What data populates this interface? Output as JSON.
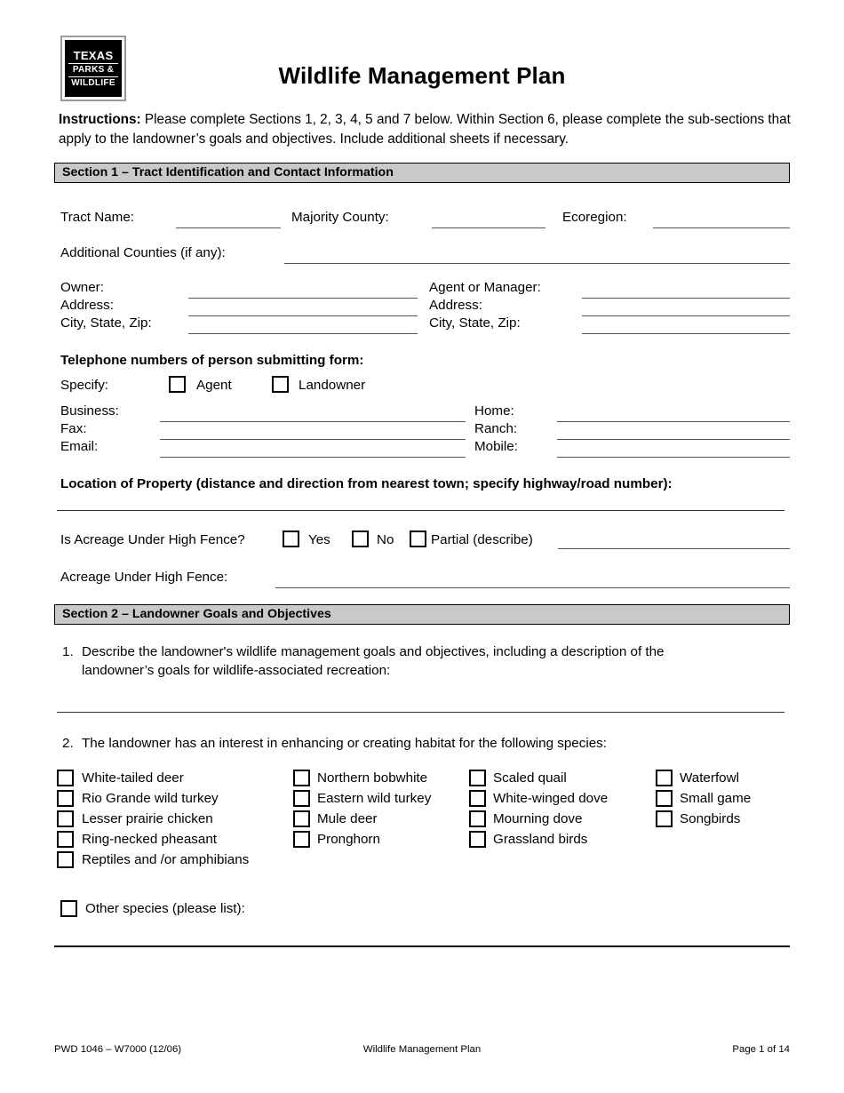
{
  "document": {
    "title": "Wildlife Management Plan",
    "logo": {
      "line1": "TEXAS",
      "line2": "PARKS &",
      "line3": "WILDLIFE"
    },
    "instructions": {
      "label": "Instructions:",
      "text": "Please complete Sections 1, 2, 3, 4, 5 and 7 below.  Within Section 6, please complete the sub-sections that apply to the landowner’s goals and objectives.  Include additional sheets if necessary."
    }
  },
  "section1": {
    "heading": "Section 1 – Tract Identification and Contact Information",
    "tract_name_label": "Tract Name:",
    "majority_county_label": "Majority County:",
    "ecoregion_label": "Ecoregion:",
    "additional_counties_label": "Additional Counties (if any):",
    "owner_label": "Owner:",
    "owner_address_label": "Address:",
    "owner_city_label": "City, State, Zip:",
    "agent_label": "Agent or Manager:",
    "agent_address_label": "Address:",
    "agent_city_label": "City, State, Zip:",
    "telephone_heading": "Telephone numbers of person submitting form:",
    "specify_label": "Specify:",
    "specify_options": [
      "Agent",
      "Landowner"
    ],
    "business_label": "Business:",
    "fax_label": "Fax:",
    "email_label": "Email:",
    "home_label": "Home:",
    "ranch_label": "Ranch:",
    "mobile_label": "Mobile:",
    "location_heading": "Location of Property (distance and direction from nearest town; specify highway/road number):",
    "high_fence_question": "Is Acreage Under High Fence?",
    "high_fence_options": [
      "Yes",
      "No",
      "Partial (describe)"
    ],
    "acreage_label": "Acreage Under High Fence:"
  },
  "section2": {
    "heading": "Section 2 – Landowner Goals and Objectives",
    "item1_number": "1.",
    "item1_line1": "Describe the landowner's wildlife management goals and objectives, including a description of the",
    "item1_line2": "landowner’s goals for wildlife-associated recreation:",
    "item2_number": "2.",
    "item2_text": "The landowner has an interest in enhancing or creating habitat for the following species:",
    "species_columns": [
      {
        "items": [
          "White-tailed deer",
          "Rio Grande wild turkey",
          "Lesser prairie chicken",
          "Ring-necked pheasant",
          "Reptiles and /or amphibians"
        ]
      },
      {
        "items": [
          "Northern bobwhite",
          "Eastern wild turkey",
          "Mule deer",
          "Pronghorn"
        ]
      },
      {
        "items": [
          "Scaled quail",
          "White-winged dove",
          "Mourning dove",
          "Grassland birds"
        ]
      },
      {
        "items": [
          "Waterfowl",
          "Small game",
          "Songbirds"
        ]
      }
    ],
    "other_species_label": "Other species (please list):"
  },
  "footer": {
    "left": "PWD 1046 – W7000 (12/06)",
    "center": "Wildlife Management Plan",
    "right": "Page 1 of 14"
  },
  "colors": {
    "section_bar_fill": "#c9c9c9",
    "rule": "#555555",
    "text": "#000000"
  }
}
